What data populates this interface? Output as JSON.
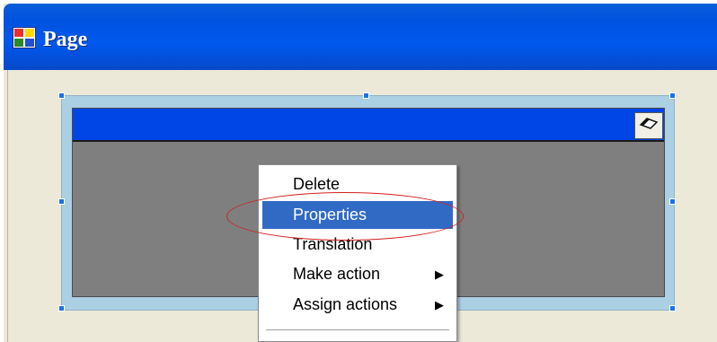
{
  "window": {
    "title": "Page"
  },
  "context_menu": {
    "items": [
      {
        "label": "Delete",
        "has_submenu": false,
        "highlighted": false
      },
      {
        "label": "Properties",
        "has_submenu": false,
        "highlighted": true
      },
      {
        "label": "Translation",
        "has_submenu": false,
        "highlighted": false
      },
      {
        "label": "Make action",
        "has_submenu": true,
        "highlighted": false
      },
      {
        "label": "Assign actions",
        "has_submenu": true,
        "highlighted": false
      }
    ],
    "submenu_arrow": "▶"
  },
  "colors": {
    "highlight": "#316ac5",
    "annotation": "#d12020",
    "widget_bar": "#0045e6"
  }
}
